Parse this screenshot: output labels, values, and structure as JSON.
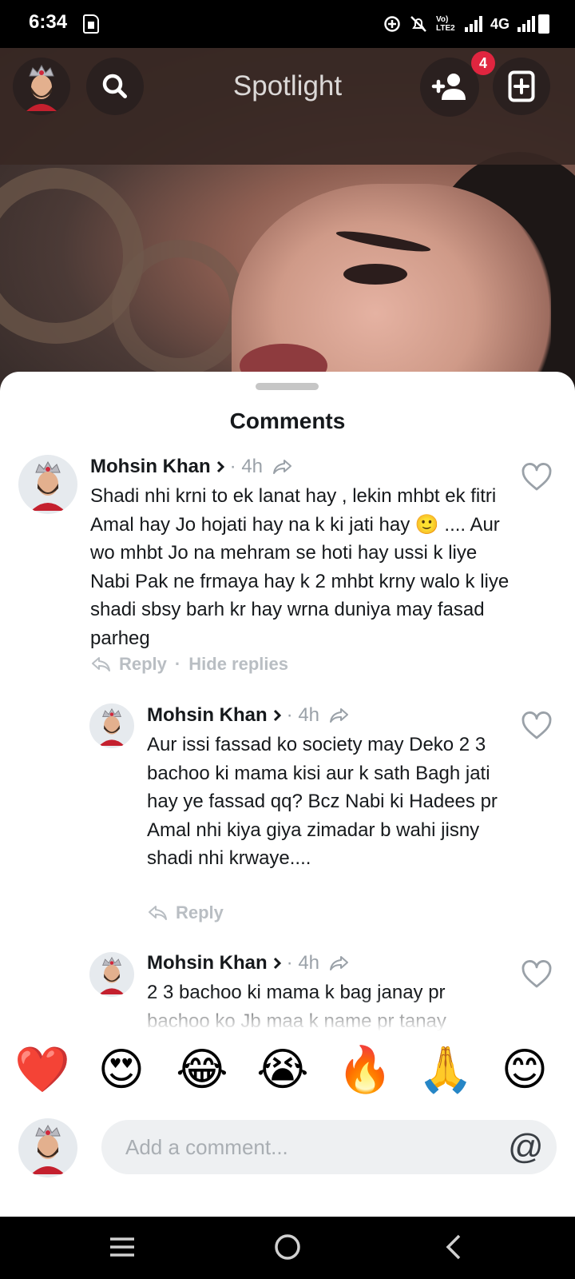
{
  "status_bar": {
    "time": "6:34",
    "network": "4G",
    "volte": "Vo) LTE2"
  },
  "header": {
    "title": "Spotlight",
    "friend_request_count": "4"
  },
  "sheet": {
    "title": "Comments"
  },
  "comments": [
    {
      "author": "Mohsin Khan",
      "time": "· 4h",
      "text": "Shadi nhi krni to ek lanat hay , lekin mhbt ek fitri Amal hay Jo hojati hay na k ki jati hay 🙂 .... Aur wo mhbt Jo na mehram se hoti hay ussi k liye Nabi Pak ne frmaya hay k 2 mhbt krny walo k liye shadi sbsy barh kr hay wrna duniya may fasad parheg",
      "reply_label": "Reply",
      "hide_replies_label": "Hide replies"
    },
    {
      "author": "Mohsin Khan",
      "time": "· 4h",
      "text": "Aur issi fassad ko society may Deko 2 3 bachoo ki mama kisi aur k sath Bagh jati hay ye fassad qq? Bcz Nabi ki Hadees pr Amal nhi kiya giya zimadar b wahi jisny shadi nhi krwaye....",
      "reply_label": "Reply"
    },
    {
      "author": "Mohsin Khan",
      "time": "· 4h",
      "text": "2 3 bachoo ki mama k bag janay pr bachoo ko Jb maa k name pr tanay"
    }
  ],
  "reactions": [
    "❤️",
    "😍",
    "😂",
    "😭",
    "🔥",
    "🙏",
    "😊"
  ],
  "composer": {
    "placeholder": "Add a comment...",
    "mention_symbol": "@"
  },
  "colors": {
    "badge": "#e0253f",
    "muted": "#9aa1a8",
    "sheet_bg": "#ffffff"
  }
}
